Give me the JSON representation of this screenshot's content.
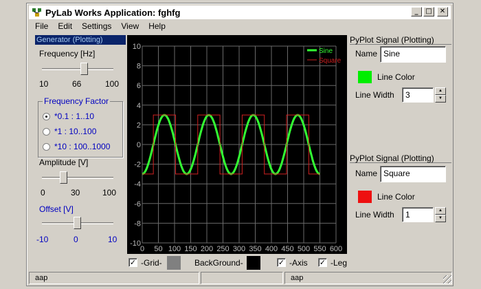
{
  "window": {
    "title": "PyLab Works Application: fghfg"
  },
  "menu": [
    {
      "label": "File"
    },
    {
      "label": "Edit"
    },
    {
      "label": "Settings"
    },
    {
      "label": "View"
    },
    {
      "label": "Help"
    }
  ],
  "generator": {
    "header": "Generator (Plotting)",
    "frequency_label": "Frequency [Hz]",
    "frequency_ticks": [
      "10",
      "66",
      "100"
    ],
    "frequency_value": 66,
    "factor_group_title": "Frequency Factor",
    "factor_options": [
      "*0.1 : 1..10",
      "*1 : 10..100",
      "*10 : 100..1000"
    ],
    "factor_selected": 0,
    "amplitude_label": "Amplitude [V]",
    "amplitude_ticks": [
      "0",
      "30",
      "100"
    ],
    "amplitude_value": 30,
    "offset_label": "Offset [V]",
    "offset_ticks": [
      "-10",
      "0",
      "10"
    ],
    "offset_value": 0
  },
  "chart_data": {
    "type": "line",
    "xlim": [
      0,
      600
    ],
    "ylim": [
      -10,
      10
    ],
    "x_ticks": [
      "0",
      "50",
      "100",
      "150",
      "200",
      "250",
      "300",
      "350",
      "400",
      "450",
      "500",
      "550",
      "600"
    ],
    "y_ticks": [
      "10",
      "8",
      "6",
      "4",
      "2",
      "0",
      "-2",
      "-4",
      "-6",
      "-8",
      "-10"
    ],
    "grid": true,
    "legend_position": "top-right",
    "series": [
      {
        "name": "Sine",
        "kind": "sine",
        "amplitude": 3,
        "periods": 4,
        "x_start": 0,
        "x_end": 550,
        "color": "#33ff33"
      },
      {
        "name": "Square",
        "kind": "square",
        "amplitude": 3,
        "periods": 4,
        "x_start": 0,
        "x_end": 550,
        "color": "#d02020"
      }
    ]
  },
  "bottom_bar": {
    "grid_label": "-Grid-",
    "grid_checked": true,
    "grid_color": "#808080",
    "background_label": "BackGround-",
    "background_color": "#000000",
    "axis_label": "-Axis",
    "axis_checked": true,
    "legend_label": "-Leg",
    "legend_checked": true
  },
  "signals": [
    {
      "header": "PyPlot Signal (Plotting)",
      "name_label": "Name",
      "name_value": "Sine",
      "color_label": "Line Color",
      "color": "#00ee00",
      "width_label": "Line Width",
      "width_value": "3"
    },
    {
      "header": "PyPlot Signal (Plotting)",
      "name_label": "Name",
      "name_value": "Square",
      "color_label": "Line Color",
      "color": "#ee1010",
      "width_label": "Line Width",
      "width_value": "1"
    }
  ],
  "status": {
    "left": "aap",
    "right": "aap"
  }
}
